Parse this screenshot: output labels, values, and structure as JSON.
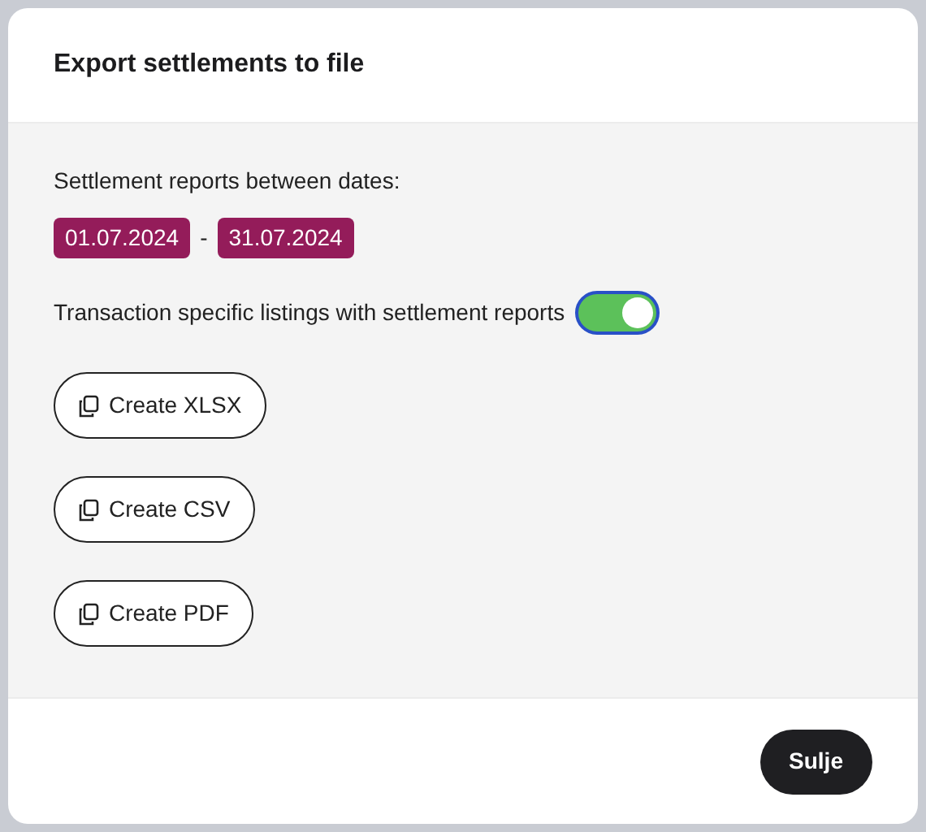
{
  "dialog": {
    "title": "Export settlements to file",
    "range_label": "Settlement reports between dates:",
    "date_from": "01.07.2024",
    "separator": "-",
    "date_to": "31.07.2024",
    "toggle": {
      "label": "Transaction specific listings with settlement reports",
      "on": true
    },
    "buttons": [
      {
        "label": "Create XLSX"
      },
      {
        "label": "Create CSV"
      },
      {
        "label": "Create PDF"
      }
    ],
    "close_button": "Sulje"
  }
}
